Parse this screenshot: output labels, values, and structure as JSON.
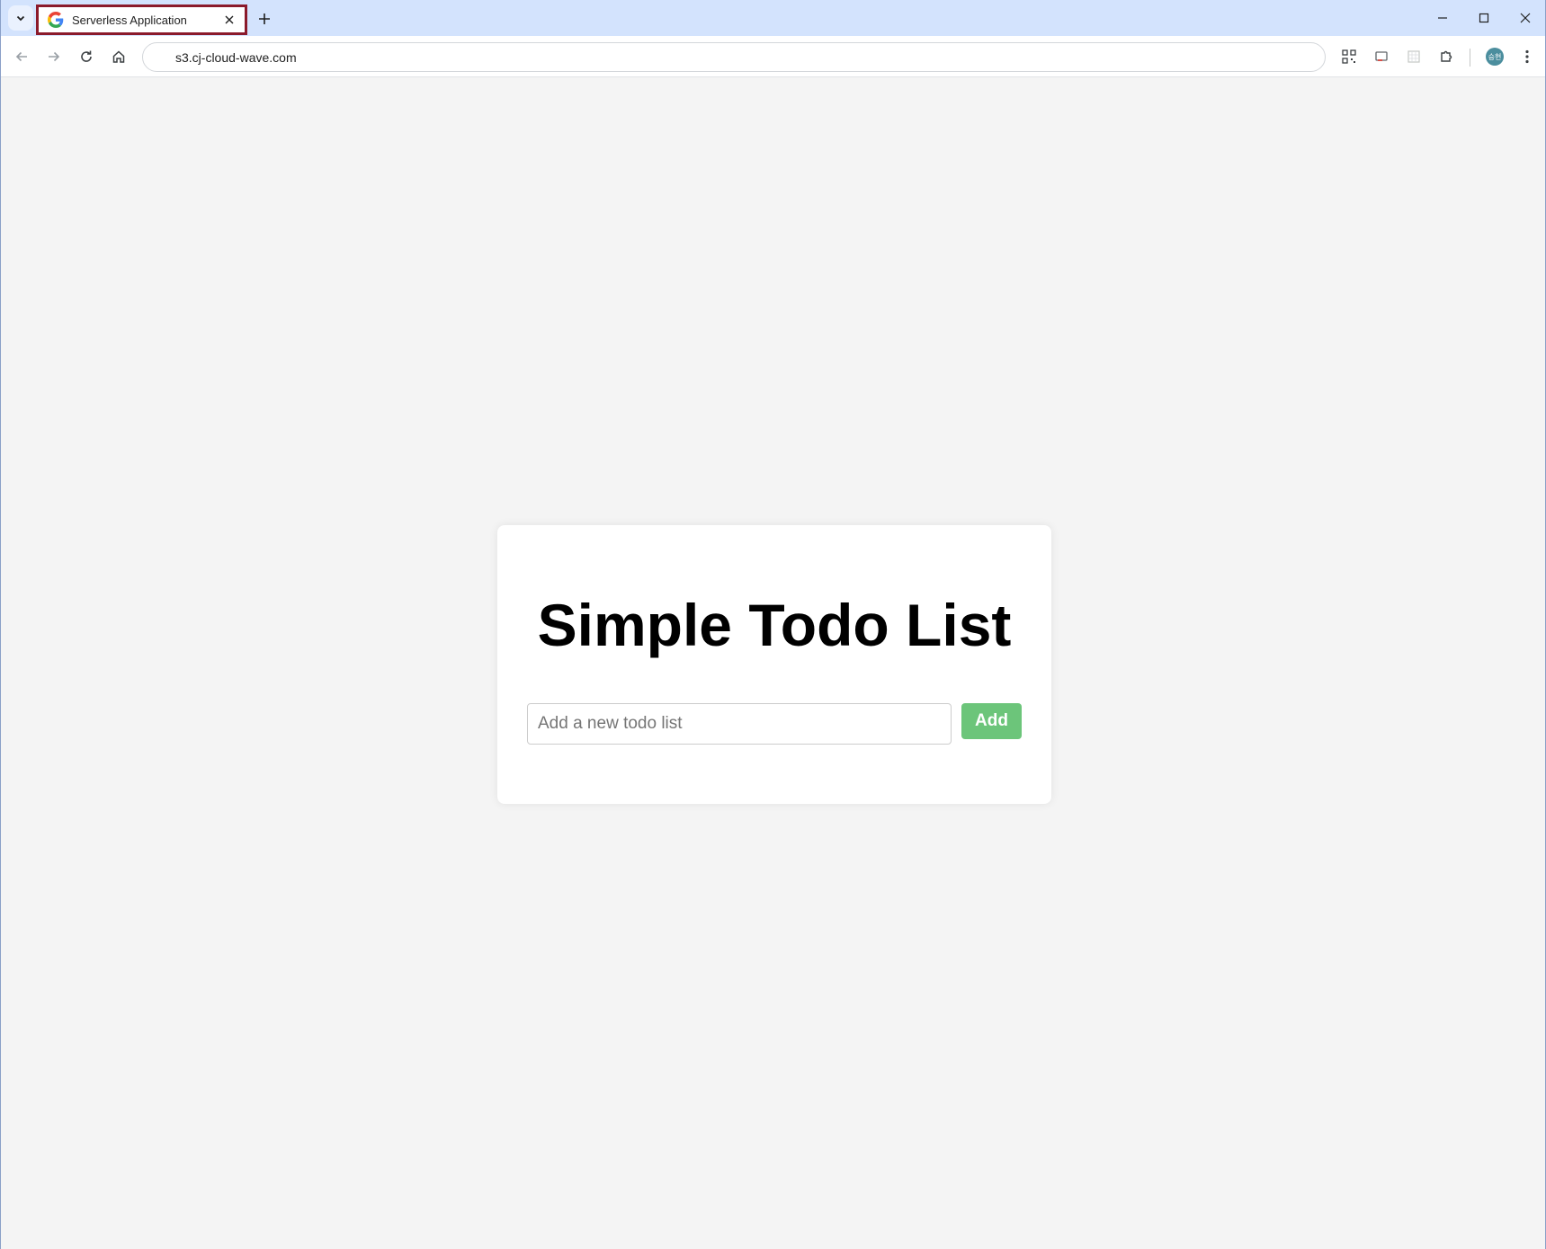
{
  "browser": {
    "tab": {
      "title": "Serverless Application",
      "favicon": "google-g-icon"
    },
    "address_bar": {
      "url": "s3.cj-cloud-wave.com"
    },
    "profile_avatar_text": "승현",
    "colors": {
      "tab_highlight_border": "#8b1a2b",
      "tabstrip_background": "#d3e3fd"
    }
  },
  "page": {
    "heading": "Simple Todo List",
    "todo_input": {
      "placeholder": "Add a new todo list",
      "value": ""
    },
    "add_button_label": "Add",
    "colors": {
      "add_button": "#6cc57a",
      "page_background": "#f4f4f4",
      "card_background": "#ffffff"
    }
  }
}
